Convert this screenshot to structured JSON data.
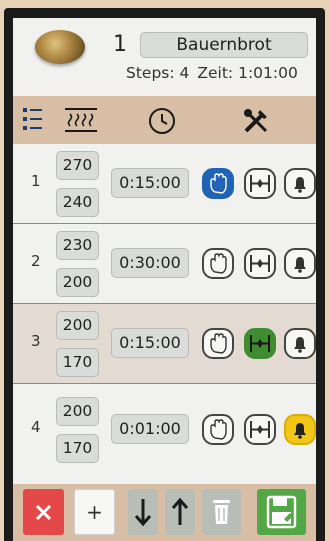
{
  "recipe": {
    "number": "1",
    "name": "Bauernbrot",
    "steps_label": "Steps: 4",
    "time_label": "Zeit: 1:01:00"
  },
  "toolbar": {
    "icons": [
      "list-icon",
      "heat-icon",
      "clock-icon",
      "tools-icon"
    ]
  },
  "steps": [
    {
      "no": "1",
      "temp_top": "270",
      "temp_bottom": "240",
      "duration": "0:15:00",
      "steam": true,
      "fan": false,
      "alarm": false
    },
    {
      "no": "2",
      "temp_top": "230",
      "temp_bottom": "200",
      "duration": "0:30:00",
      "steam": false,
      "fan": false,
      "alarm": false
    },
    {
      "no": "3",
      "temp_top": "200",
      "temp_bottom": "170",
      "duration": "0:15:00",
      "steam": false,
      "fan": true,
      "alarm": false
    },
    {
      "no": "4",
      "temp_top": "200",
      "temp_bottom": "170",
      "duration": "0:01:00",
      "steam": false,
      "fan": false,
      "alarm": true
    }
  ],
  "footer": {
    "add_label": "+"
  },
  "colors": {
    "steam_on": "#1f62b6",
    "fan_on": "#3f8c31",
    "alarm_on": "#f2c616",
    "delete": "#e44848",
    "save": "#52a845",
    "toolbar_bg": "#d7bea5"
  }
}
